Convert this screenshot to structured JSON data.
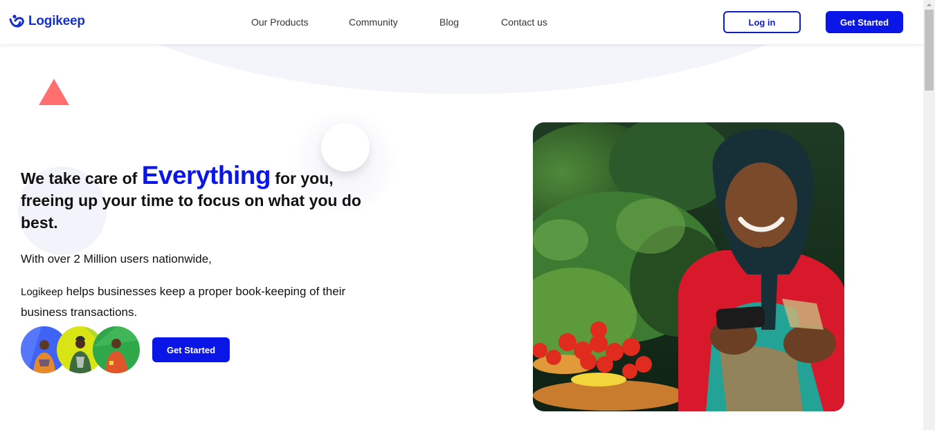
{
  "brand": {
    "name": "Logikeep",
    "color": "#1531c9"
  },
  "nav": {
    "items": [
      {
        "label": "Our Products"
      },
      {
        "label": "Community"
      },
      {
        "label": "Blog"
      },
      {
        "label": "Contact us"
      }
    ]
  },
  "header": {
    "login_label": "Log in",
    "get_started_label": "Get Started"
  },
  "hero": {
    "headline_start": "We take care of ",
    "headline_accent": "Everything",
    "headline_end": " for you, freeing up your time to focus on what you do best.",
    "subline": "With over 2 Million users nationwide,",
    "desc_brand": "Logikeep",
    "desc_rest": " helps businesses keep a proper book-keeping of their business transactions.",
    "cta_label": "Get Started",
    "avatars": [
      {
        "name": "user-avatar-1",
        "bg": "#3f63f5"
      },
      {
        "name": "user-avatar-2",
        "bg": "#d9e414"
      },
      {
        "name": "user-avatar-3",
        "bg": "#2fa84a"
      }
    ]
  },
  "colors": {
    "accent": "#0a16e6",
    "triangle": "#ff6f6f",
    "background_shape": "#f4f5fb"
  }
}
